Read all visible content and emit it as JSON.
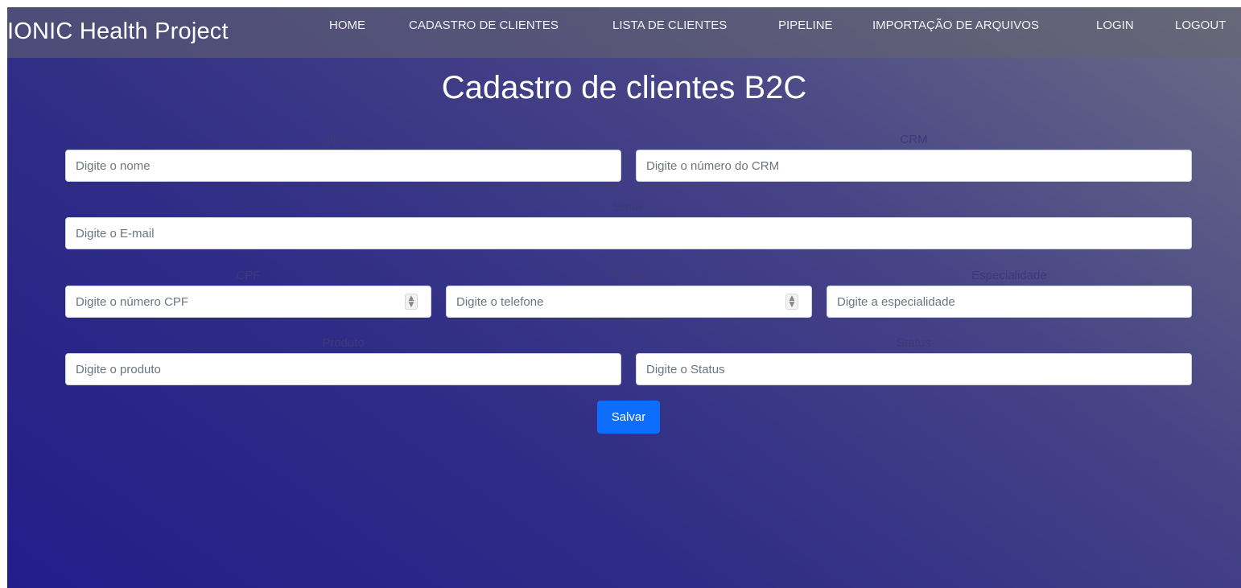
{
  "app": {
    "brand": "IONIC Health Project"
  },
  "nav": {
    "home": "HOME",
    "cadastro": "CADASTRO DE CLIENTES",
    "lista": "LISTA DE CLIENTES",
    "pipeline": "PIPELINE",
    "importacao": "IMPORTAÇÃO DE ARQUIVOS",
    "login": "LOGIN",
    "logout": "LOGOUT"
  },
  "page": {
    "title": "Cadastro de clientes B2C"
  },
  "form": {
    "nome": {
      "label": "Nome",
      "placeholder": "Digite o nome",
      "value": ""
    },
    "crm": {
      "label": "CRM",
      "placeholder": "Digite o número do CRM",
      "value": ""
    },
    "email": {
      "label": "Email",
      "placeholder": "Digite o E-mail",
      "value": ""
    },
    "cpf": {
      "label": "CPF",
      "placeholder": "Digite o número CPF",
      "value": ""
    },
    "telefone": {
      "label": "Telefone",
      "placeholder": "Digite o telefone",
      "value": ""
    },
    "especialidade": {
      "label": "Especialidade",
      "placeholder": "Digite a especialidade",
      "value": ""
    },
    "produto": {
      "label": "Produto",
      "placeholder": "Digite o produto",
      "value": ""
    },
    "status": {
      "label": "Status",
      "placeholder": "Digite o Status",
      "value": ""
    },
    "save_label": "Salvar"
  },
  "icons": {
    "spinner": "number-stepper-icon"
  },
  "colors": {
    "primary_button": "#0d6efd",
    "gradient_dark": "#231d8a",
    "gradient_light": "#6a6c86"
  }
}
